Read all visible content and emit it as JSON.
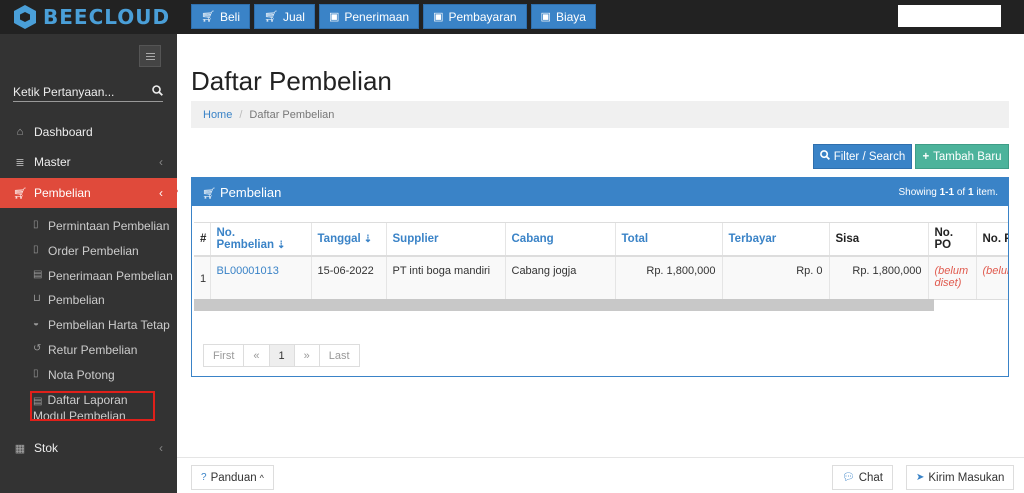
{
  "brand": {
    "name": "BEECLOUD"
  },
  "topnav": [
    {
      "label": "Beli",
      "icon": "cart-icon"
    },
    {
      "label": "Jual",
      "icon": "cart-icon"
    },
    {
      "label": "Penerimaan",
      "icon": "money-icon"
    },
    {
      "label": "Pembayaran",
      "icon": "money-icon"
    },
    {
      "label": "Biaya",
      "icon": "money-icon"
    }
  ],
  "sidebar": {
    "search_placeholder": "Ketik Pertanyaan...",
    "items": [
      {
        "label": "Dashboard",
        "icon": "home-icon"
      },
      {
        "label": "Master",
        "icon": "database-icon"
      },
      {
        "label": "Pembelian",
        "icon": "cart-icon",
        "active": true
      },
      {
        "label": "Stok",
        "icon": "box-icon"
      }
    ],
    "subitems": [
      {
        "label": "Permintaan Pembelian",
        "icon": "file-icon"
      },
      {
        "label": "Order Pembelian",
        "icon": "file-icon"
      },
      {
        "label": "Penerimaan Pembelian",
        "icon": "book-icon"
      },
      {
        "label": "Pembelian",
        "icon": "cart-icon"
      },
      {
        "label": "Pembelian Harta Tetap",
        "icon": "car-icon"
      },
      {
        "label": "Retur Pembelian",
        "icon": "undo-icon"
      },
      {
        "label": "Nota Potong",
        "icon": "file-icon"
      },
      {
        "label": "Daftar Laporan Modul Pembelian",
        "icon": "book-icon"
      }
    ]
  },
  "main": {
    "title": "Daftar Pembelian",
    "breadcrumb": {
      "home": "Home",
      "separator": "/",
      "current": "Daftar Pembelian"
    },
    "filter_button": "Filter / Search",
    "add_button": "Tambah Baru",
    "panel": {
      "title": "Pembelian",
      "showing_prefix": "Showing ",
      "showing_range": "1-1",
      "showing_of": " of ",
      "showing_total": "1",
      "showing_suffix": " item."
    },
    "table": {
      "headers": [
        "#",
        "No. Pembelian",
        "Tanggal",
        "Supplier",
        "Cabang",
        "Total",
        "Terbayar",
        "Sisa",
        "No. PO",
        "No. P"
      ],
      "rows": [
        [
          "1",
          "BL00001013",
          "15-06-2022",
          "PT inti boga mandiri",
          "Cabang jogja",
          "Rp. 1,800,000",
          "Rp. 0",
          "Rp. 1,800,000",
          "(belum diset)",
          "(belum diset)"
        ]
      ]
    },
    "pager": [
      "First",
      "«",
      "1",
      "»",
      "Last"
    ]
  },
  "footer": {
    "guide": "Panduan",
    "chat": "Chat",
    "feedback": "Kirim Masukan"
  },
  "colors": {
    "primary": "#3a83c7",
    "active": "#e04a3b",
    "success": "#4cb39b"
  }
}
